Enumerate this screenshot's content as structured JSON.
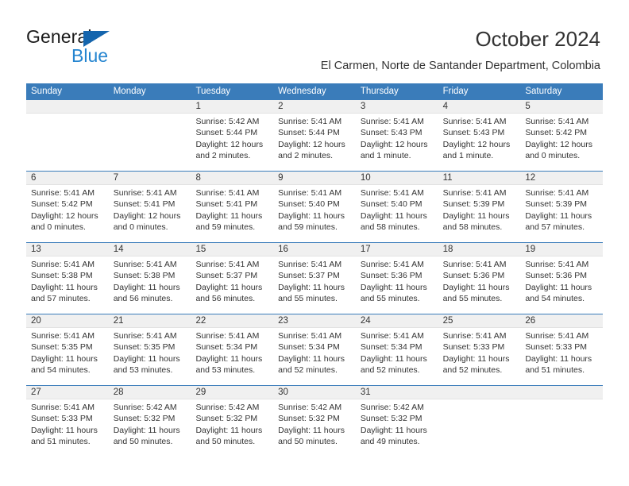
{
  "brand": {
    "name_primary": "General",
    "name_secondary": "Blue",
    "triangle_icon": "triangle-icon",
    "accent_color": "#2585d0",
    "header_color": "#3a7cba"
  },
  "header": {
    "title": "October 2024",
    "subtitle": "El Carmen, Norte de Santander Department, Colombia"
  },
  "calendar": {
    "weekdays": [
      "Sunday",
      "Monday",
      "Tuesday",
      "Wednesday",
      "Thursday",
      "Friday",
      "Saturday"
    ],
    "weeks": [
      [
        {
          "day": "",
          "empty": true
        },
        {
          "day": "",
          "empty": true
        },
        {
          "day": "1",
          "sunrise": "Sunrise: 5:42 AM",
          "sunset": "Sunset: 5:44 PM",
          "daylight": "Daylight: 12 hours and 2 minutes."
        },
        {
          "day": "2",
          "sunrise": "Sunrise: 5:41 AM",
          "sunset": "Sunset: 5:44 PM",
          "daylight": "Daylight: 12 hours and 2 minutes."
        },
        {
          "day": "3",
          "sunrise": "Sunrise: 5:41 AM",
          "sunset": "Sunset: 5:43 PM",
          "daylight": "Daylight: 12 hours and 1 minute."
        },
        {
          "day": "4",
          "sunrise": "Sunrise: 5:41 AM",
          "sunset": "Sunset: 5:43 PM",
          "daylight": "Daylight: 12 hours and 1 minute."
        },
        {
          "day": "5",
          "sunrise": "Sunrise: 5:41 AM",
          "sunset": "Sunset: 5:42 PM",
          "daylight": "Daylight: 12 hours and 0 minutes."
        }
      ],
      [
        {
          "day": "6",
          "sunrise": "Sunrise: 5:41 AM",
          "sunset": "Sunset: 5:42 PM",
          "daylight": "Daylight: 12 hours and 0 minutes."
        },
        {
          "day": "7",
          "sunrise": "Sunrise: 5:41 AM",
          "sunset": "Sunset: 5:41 PM",
          "daylight": "Daylight: 12 hours and 0 minutes."
        },
        {
          "day": "8",
          "sunrise": "Sunrise: 5:41 AM",
          "sunset": "Sunset: 5:41 PM",
          "daylight": "Daylight: 11 hours and 59 minutes."
        },
        {
          "day": "9",
          "sunrise": "Sunrise: 5:41 AM",
          "sunset": "Sunset: 5:40 PM",
          "daylight": "Daylight: 11 hours and 59 minutes."
        },
        {
          "day": "10",
          "sunrise": "Sunrise: 5:41 AM",
          "sunset": "Sunset: 5:40 PM",
          "daylight": "Daylight: 11 hours and 58 minutes."
        },
        {
          "day": "11",
          "sunrise": "Sunrise: 5:41 AM",
          "sunset": "Sunset: 5:39 PM",
          "daylight": "Daylight: 11 hours and 58 minutes."
        },
        {
          "day": "12",
          "sunrise": "Sunrise: 5:41 AM",
          "sunset": "Sunset: 5:39 PM",
          "daylight": "Daylight: 11 hours and 57 minutes."
        }
      ],
      [
        {
          "day": "13",
          "sunrise": "Sunrise: 5:41 AM",
          "sunset": "Sunset: 5:38 PM",
          "daylight": "Daylight: 11 hours and 57 minutes."
        },
        {
          "day": "14",
          "sunrise": "Sunrise: 5:41 AM",
          "sunset": "Sunset: 5:38 PM",
          "daylight": "Daylight: 11 hours and 56 minutes."
        },
        {
          "day": "15",
          "sunrise": "Sunrise: 5:41 AM",
          "sunset": "Sunset: 5:37 PM",
          "daylight": "Daylight: 11 hours and 56 minutes."
        },
        {
          "day": "16",
          "sunrise": "Sunrise: 5:41 AM",
          "sunset": "Sunset: 5:37 PM",
          "daylight": "Daylight: 11 hours and 55 minutes."
        },
        {
          "day": "17",
          "sunrise": "Sunrise: 5:41 AM",
          "sunset": "Sunset: 5:36 PM",
          "daylight": "Daylight: 11 hours and 55 minutes."
        },
        {
          "day": "18",
          "sunrise": "Sunrise: 5:41 AM",
          "sunset": "Sunset: 5:36 PM",
          "daylight": "Daylight: 11 hours and 55 minutes."
        },
        {
          "day": "19",
          "sunrise": "Sunrise: 5:41 AM",
          "sunset": "Sunset: 5:36 PM",
          "daylight": "Daylight: 11 hours and 54 minutes."
        }
      ],
      [
        {
          "day": "20",
          "sunrise": "Sunrise: 5:41 AM",
          "sunset": "Sunset: 5:35 PM",
          "daylight": "Daylight: 11 hours and 54 minutes."
        },
        {
          "day": "21",
          "sunrise": "Sunrise: 5:41 AM",
          "sunset": "Sunset: 5:35 PM",
          "daylight": "Daylight: 11 hours and 53 minutes."
        },
        {
          "day": "22",
          "sunrise": "Sunrise: 5:41 AM",
          "sunset": "Sunset: 5:34 PM",
          "daylight": "Daylight: 11 hours and 53 minutes."
        },
        {
          "day": "23",
          "sunrise": "Sunrise: 5:41 AM",
          "sunset": "Sunset: 5:34 PM",
          "daylight": "Daylight: 11 hours and 52 minutes."
        },
        {
          "day": "24",
          "sunrise": "Sunrise: 5:41 AM",
          "sunset": "Sunset: 5:34 PM",
          "daylight": "Daylight: 11 hours and 52 minutes."
        },
        {
          "day": "25",
          "sunrise": "Sunrise: 5:41 AM",
          "sunset": "Sunset: 5:33 PM",
          "daylight": "Daylight: 11 hours and 52 minutes."
        },
        {
          "day": "26",
          "sunrise": "Sunrise: 5:41 AM",
          "sunset": "Sunset: 5:33 PM",
          "daylight": "Daylight: 11 hours and 51 minutes."
        }
      ],
      [
        {
          "day": "27",
          "sunrise": "Sunrise: 5:41 AM",
          "sunset": "Sunset: 5:33 PM",
          "daylight": "Daylight: 11 hours and 51 minutes."
        },
        {
          "day": "28",
          "sunrise": "Sunrise: 5:42 AM",
          "sunset": "Sunset: 5:32 PM",
          "daylight": "Daylight: 11 hours and 50 minutes."
        },
        {
          "day": "29",
          "sunrise": "Sunrise: 5:42 AM",
          "sunset": "Sunset: 5:32 PM",
          "daylight": "Daylight: 11 hours and 50 minutes."
        },
        {
          "day": "30",
          "sunrise": "Sunrise: 5:42 AM",
          "sunset": "Sunset: 5:32 PM",
          "daylight": "Daylight: 11 hours and 50 minutes."
        },
        {
          "day": "31",
          "sunrise": "Sunrise: 5:42 AM",
          "sunset": "Sunset: 5:32 PM",
          "daylight": "Daylight: 11 hours and 49 minutes."
        },
        {
          "day": "",
          "empty": true
        },
        {
          "day": "",
          "empty": true
        }
      ]
    ]
  }
}
